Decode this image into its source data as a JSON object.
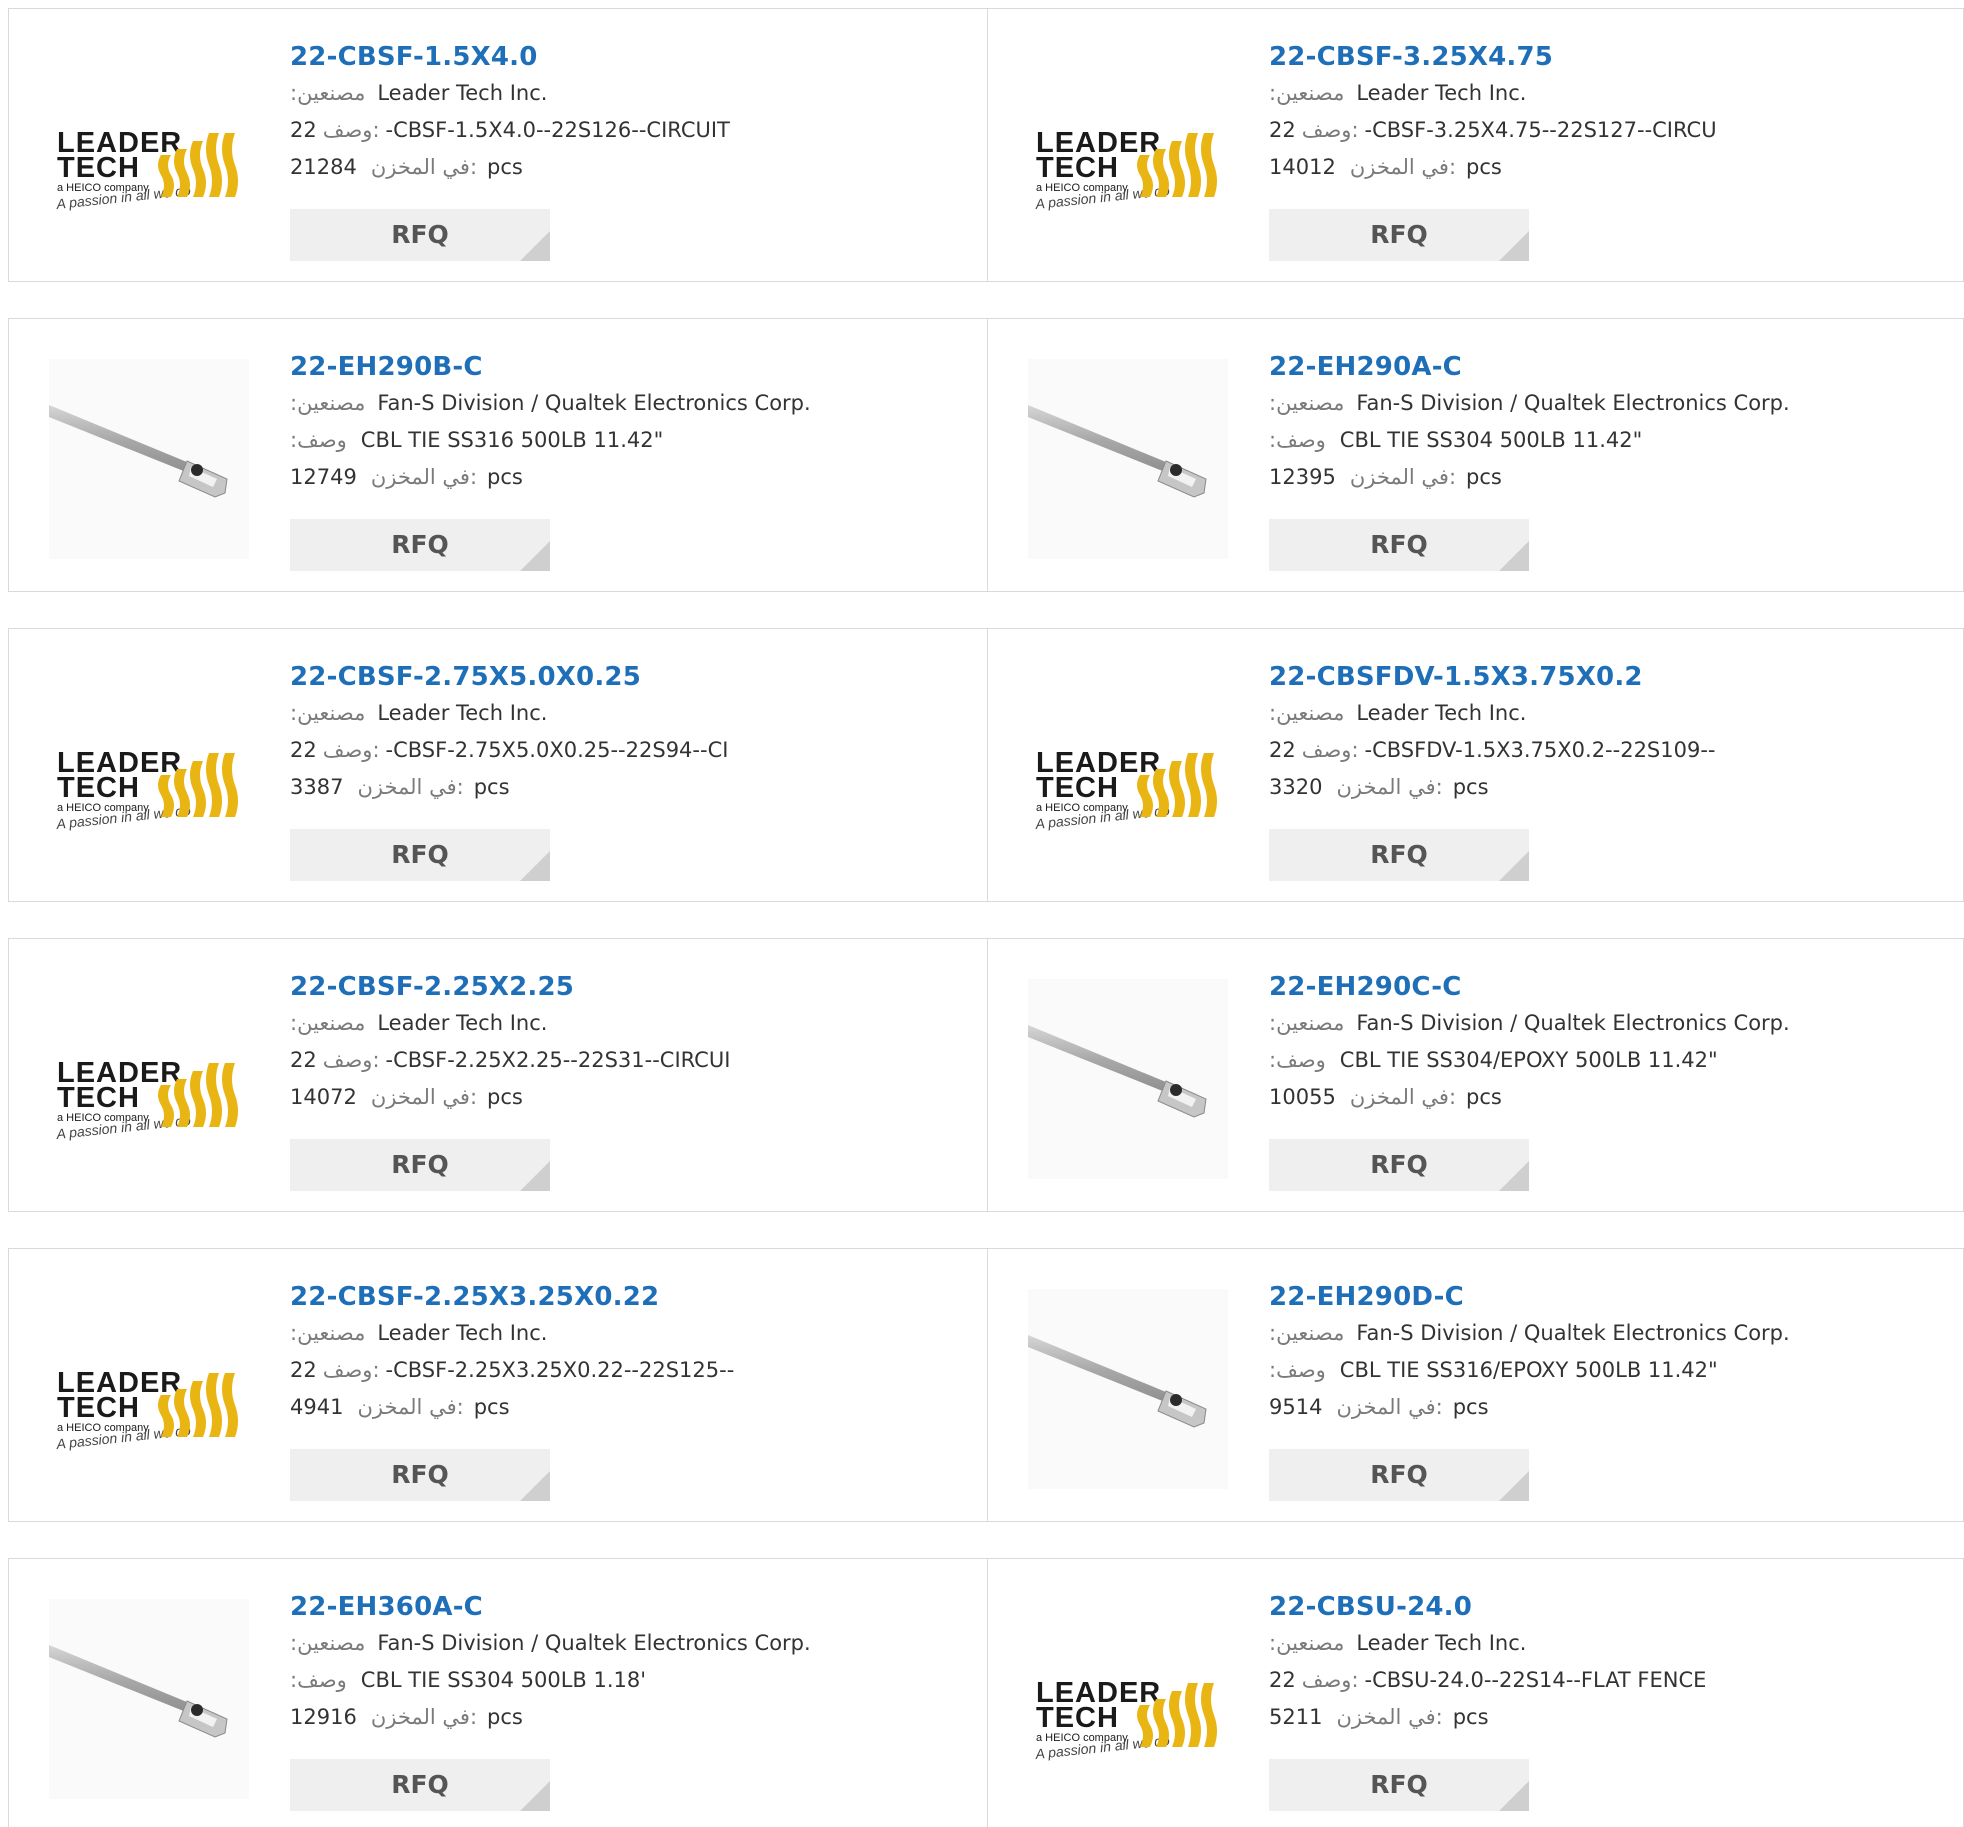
{
  "labels": {
    "manufacturer": ":مصنعين",
    "description": "وصف:",
    "description_alt": ":وصف",
    "stock": "في المخزن:",
    "unit": "pcs",
    "rfq": "RFQ"
  },
  "colors": {
    "link": "#1f6fb8",
    "border": "#d9d9d9",
    "button_bg": "#efefef",
    "button_corner": "#cfcfcf",
    "logo_yellow": "#e8b512"
  },
  "logo_text": {
    "line1": "LEADER",
    "line2": "TECH",
    "line3": "a HEICO company",
    "line4": "A passion in all we do"
  },
  "products": [
    {
      "name": "22-CBSF-1.5X4.0",
      "manufacturer": "Leader Tech Inc.",
      "desc_prefix": "22",
      "description": "-CBSF-1.5X4.0--22S126--CIRCUIT",
      "stock": "21284",
      "image": "leader-tech-logo"
    },
    {
      "name": "22-CBSF-3.25X4.75",
      "manufacturer": "Leader Tech Inc.",
      "desc_prefix": "22",
      "description": "-CBSF-3.25X4.75--22S127--CIRCU",
      "stock": "14012",
      "image": "leader-tech-logo"
    },
    {
      "name": "22-EH290B-C",
      "manufacturer": "Fan-S Division / Qualtek Electronics Corp.",
      "desc_prefix": "",
      "description": "CBL TIE SS316 500LB 11.42\"",
      "stock": "12749",
      "image": "cable-tie-photo"
    },
    {
      "name": "22-EH290A-C",
      "manufacturer": "Fan-S Division / Qualtek Electronics Corp.",
      "desc_prefix": "",
      "description": "CBL TIE SS304 500LB 11.42\"",
      "stock": "12395",
      "image": "cable-tie-photo"
    },
    {
      "name": "22-CBSF-2.75X5.0X0.25",
      "manufacturer": "Leader Tech Inc.",
      "desc_prefix": "22",
      "description": "-CBSF-2.75X5.0X0.25--22S94--CI",
      "stock": "3387",
      "image": "leader-tech-logo"
    },
    {
      "name": "22-CBSFDV-1.5X3.75X0.2",
      "manufacturer": "Leader Tech Inc.",
      "desc_prefix": "22",
      "description": "-CBSFDV-1.5X3.75X0.2--22S109--",
      "stock": "3320",
      "image": "leader-tech-logo"
    },
    {
      "name": "22-CBSF-2.25X2.25",
      "manufacturer": "Leader Tech Inc.",
      "desc_prefix": "22",
      "description": "-CBSF-2.25X2.25--22S31--CIRCUI",
      "stock": "14072",
      "image": "leader-tech-logo"
    },
    {
      "name": "22-EH290C-C",
      "manufacturer": "Fan-S Division / Qualtek Electronics Corp.",
      "desc_prefix": "",
      "description": "CBL TIE SS304/EPOXY 500LB 11.42\"",
      "stock": "10055",
      "image": "cable-tie-photo"
    },
    {
      "name": "22-CBSF-2.25X3.25X0.22",
      "manufacturer": "Leader Tech Inc.",
      "desc_prefix": "22",
      "description": "-CBSF-2.25X3.25X0.22--22S125--",
      "stock": "4941",
      "image": "leader-tech-logo"
    },
    {
      "name": "22-EH290D-C",
      "manufacturer": "Fan-S Division / Qualtek Electronics Corp.",
      "desc_prefix": "",
      "description": "CBL TIE SS316/EPOXY 500LB 11.42\"",
      "stock": "9514",
      "image": "cable-tie-photo"
    },
    {
      "name": "22-EH360A-C",
      "manufacturer": "Fan-S Division / Qualtek Electronics Corp.",
      "desc_prefix": "",
      "description": "CBL TIE SS304 500LB 1.18'",
      "stock": "12916",
      "image": "cable-tie-photo"
    },
    {
      "name": "22-CBSU-24.0",
      "manufacturer": "Leader Tech Inc.",
      "desc_prefix": "22",
      "description": "-CBSU-24.0--22S14--FLAT FENCE",
      "stock": "5211",
      "image": "leader-tech-logo"
    }
  ]
}
